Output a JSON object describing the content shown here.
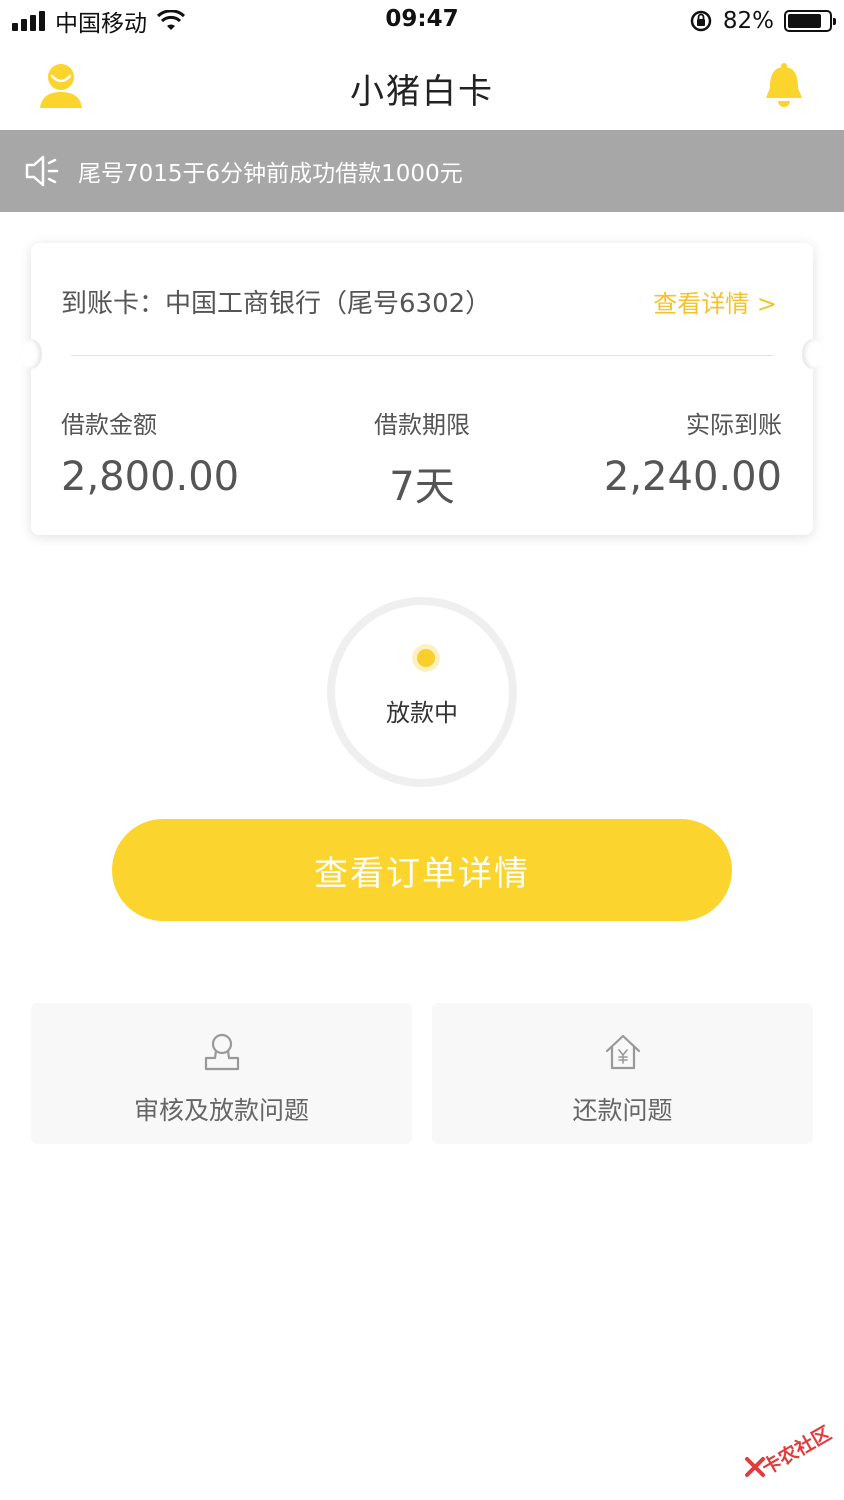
{
  "status_bar": {
    "carrier": "中国移动",
    "time": "09:47",
    "battery_percent": "82%",
    "battery_level": 0.82
  },
  "nav": {
    "title": "小猪白卡",
    "left_icon": "user-icon",
    "right_icon": "bell-icon"
  },
  "notice": {
    "icon": "speaker-icon",
    "text": "尾号7015于6分钟前成功借款1000元"
  },
  "card": {
    "account": "到账卡：中国工商银行（尾号6302）",
    "detail_link": "查看详情 >",
    "columns": [
      {
        "label": "借款金额",
        "value": "2,800.00"
      },
      {
        "label": "借款期限",
        "value": "7天"
      },
      {
        "label": "实际到账",
        "value": "2,240.00"
      }
    ]
  },
  "status": {
    "text": "放款中"
  },
  "main_button": {
    "label": "查看订单详情"
  },
  "help_tiles": [
    {
      "label": "审核及放款问题",
      "icon": "person-icon"
    },
    {
      "label": "还款问题",
      "icon": "house-yen-icon"
    }
  ],
  "watermark": {
    "text": "卡农社区"
  },
  "colors": {
    "accent": "#fbd42d",
    "link": "#f5c22a",
    "notice_bg": "#a7a7a7",
    "watermark": "#e23b3b"
  }
}
